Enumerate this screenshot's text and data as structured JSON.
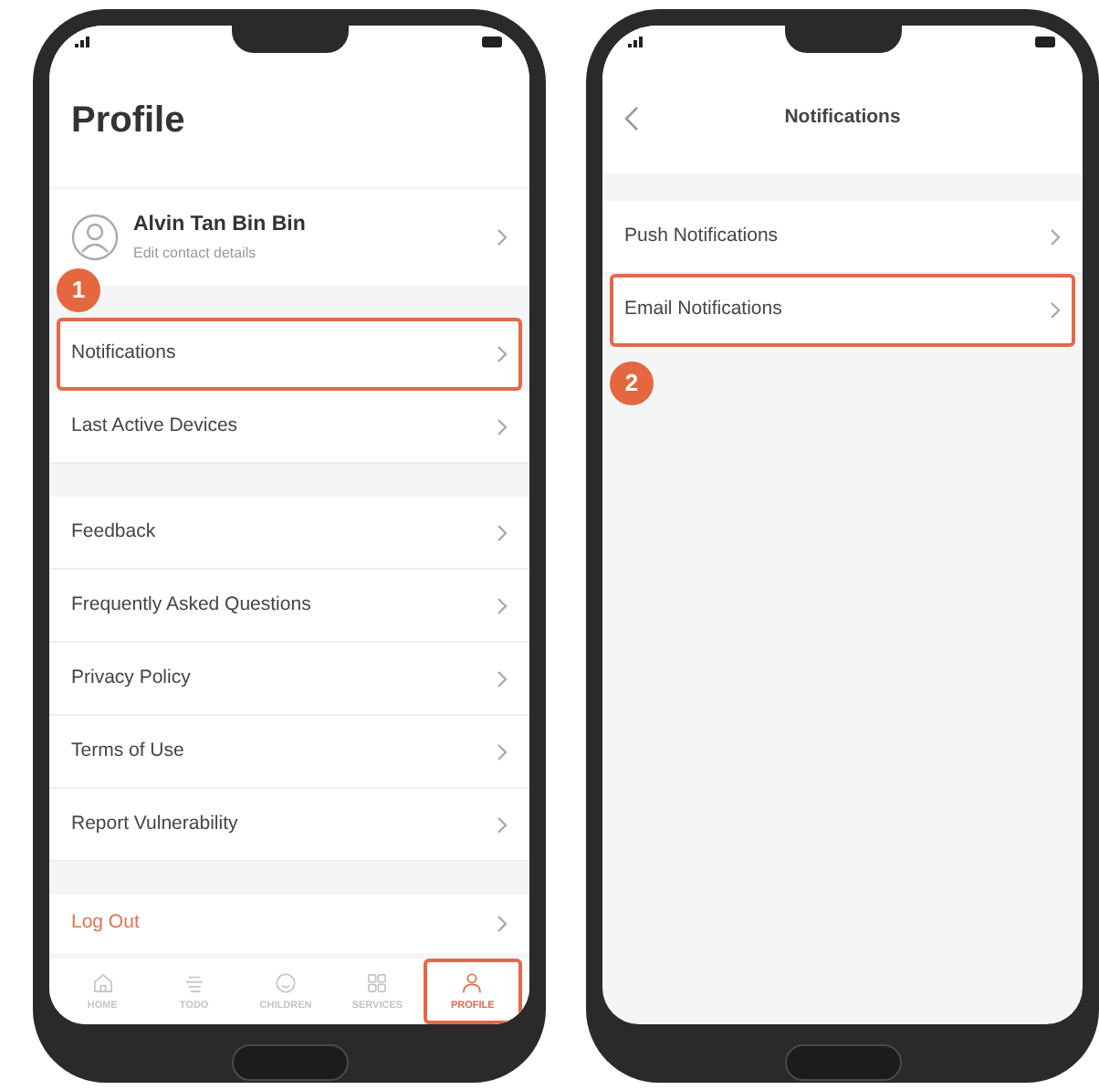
{
  "phones": [
    {
      "kind": "profile",
      "title": "Profile",
      "profile": {
        "name": "Alvin Tan Bin Bin",
        "subtitle": "Edit contact details"
      },
      "groups": [
        [
          {
            "kind": "callout",
            "label": "1"
          },
          {
            "label": "Notifications",
            "highlighted": true
          },
          {
            "label": "Last Active Devices",
            "highlighted": false
          }
        ],
        [
          {
            "label": "Feedback",
            "highlighted": false
          },
          {
            "label": "Frequently Asked Questions",
            "highlighted": false
          },
          {
            "label": "Privacy Policy",
            "highlighted": false
          },
          {
            "label": "Terms of Use",
            "highlighted": false
          },
          {
            "label": "Report Vulnerability",
            "highlighted": false
          }
        ],
        [
          {
            "label": "Log Out",
            "highlighted": false,
            "kind": "danger"
          }
        ]
      ],
      "tabs": [
        {
          "label": "HOME",
          "selected": false,
          "highlighted": false
        },
        {
          "label": "TODO",
          "selected": false,
          "highlighted": false
        },
        {
          "label": "CHILDREN",
          "selected": false,
          "highlighted": false
        },
        {
          "label": "SERVICES",
          "selected": false,
          "highlighted": false
        },
        {
          "label": "PROFILE",
          "selected": true,
          "highlighted": true
        }
      ]
    },
    {
      "kind": "detail",
      "title": "Notifications",
      "groups": [
        [
          {
            "label": "Push Notifications",
            "highlighted": false
          },
          {
            "label": "Email Notifications",
            "highlighted": true
          },
          {
            "kind": "callout",
            "label": "2"
          }
        ]
      ]
    }
  ]
}
